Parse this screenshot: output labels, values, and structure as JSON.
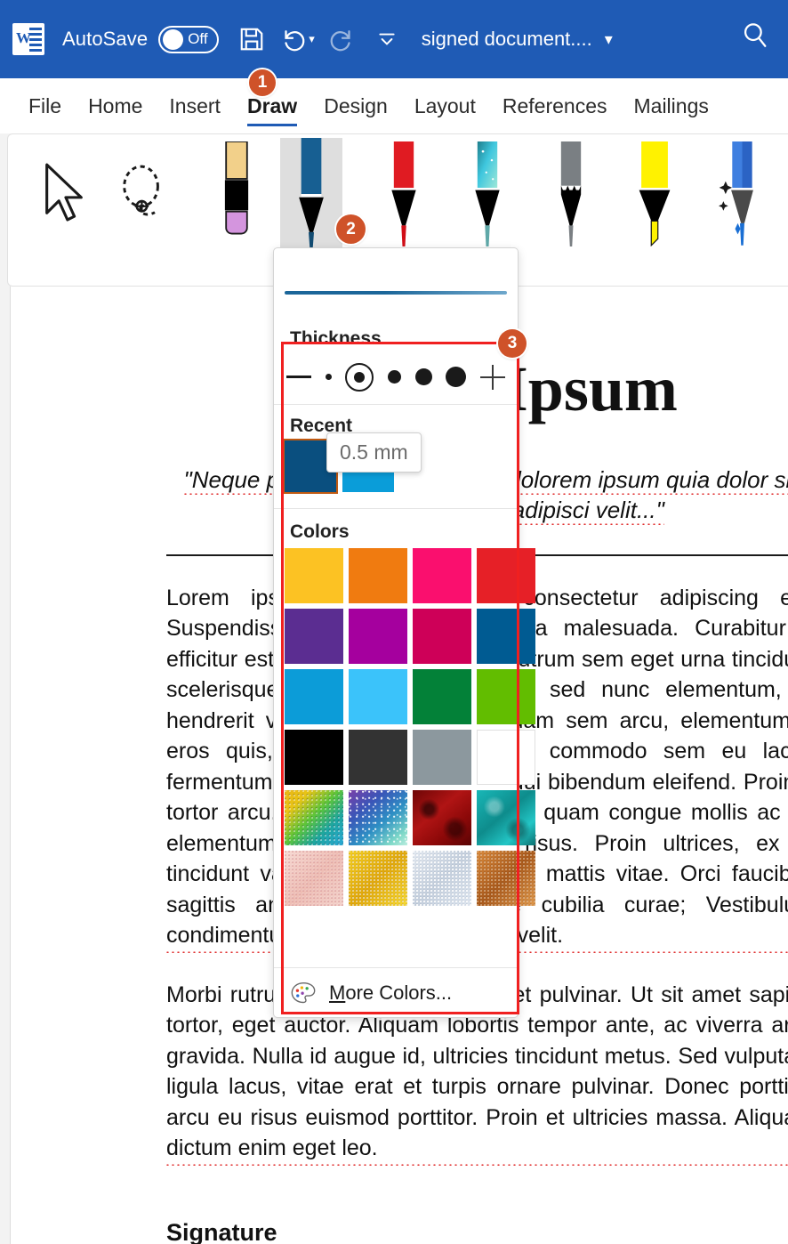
{
  "titlebar": {
    "logo_name": "word-logo",
    "autosave_label": "AutoSave",
    "autosave_state": "Off",
    "save_icon": "save-icon",
    "undo_icon": "undo-icon",
    "redo_icon": "redo-icon",
    "customize_icon": "customize-quick-access-icon",
    "document_title": "signed document....",
    "title_chevron": "chevron-down-icon",
    "search_icon": "search-icon",
    "accent_color": "#1f5bb5"
  },
  "ribbon": {
    "tabs": [
      {
        "label": "File",
        "active": false
      },
      {
        "label": "Home",
        "active": false
      },
      {
        "label": "Insert",
        "active": false
      },
      {
        "label": "Draw",
        "active": true
      },
      {
        "label": "Design",
        "active": false
      },
      {
        "label": "Layout",
        "active": false
      },
      {
        "label": "References",
        "active": false
      },
      {
        "label": "Mailings",
        "active": false
      }
    ]
  },
  "pen_toolbar": {
    "tools": [
      {
        "name": "select-tool",
        "kind": "cursor",
        "selected": false
      },
      {
        "name": "lasso-select-tool",
        "kind": "lasso",
        "selected": false
      },
      {
        "name": "eraser-tool",
        "kind": "eraser",
        "barrel": "#F2D08A",
        "mid": "#000000",
        "tip": "#D495DE",
        "selected": false
      },
      {
        "name": "pen-blue",
        "kind": "pen",
        "barrel": "#175F92",
        "mid": "#000000",
        "tip": "#124C72",
        "selected": true
      },
      {
        "name": "pen-red",
        "kind": "pen",
        "barrel": "#E01B22",
        "mid": "#000000",
        "tip": "#D10E17",
        "selected": false
      },
      {
        "name": "pen-galaxy",
        "kind": "pen",
        "barrel": "galaxy",
        "mid": "#000000",
        "tip": "#5FA8A8",
        "selected": false
      },
      {
        "name": "pencil-gray",
        "kind": "pencil",
        "barrel": "#7A7F83",
        "mid": "#000000",
        "tip": "#7A7F83",
        "selected": false
      },
      {
        "name": "highlighter-yellow",
        "kind": "highlighter",
        "barrel": "#FFF200",
        "mid": "#000000",
        "tip": "#FFF200",
        "selected": false
      },
      {
        "name": "action-pen",
        "kind": "action",
        "barrel": "#3F7FE0",
        "mid": "#4A4A4A",
        "tip": "#1A6FD4",
        "selected": false
      }
    ]
  },
  "flyout": {
    "preview_color": "#1b6699",
    "thickness": {
      "title": "Thickness",
      "minus_label": "decrease-thickness",
      "plus_label": "increase-thickness",
      "options": [
        {
          "size": 7,
          "selected": false,
          "value": "0.25 mm"
        },
        {
          "size": 12,
          "selected": true,
          "value": "0.5 mm"
        },
        {
          "size": 15,
          "selected": false,
          "value": "1 mm"
        },
        {
          "size": 19,
          "selected": false,
          "value": "1.5 mm"
        },
        {
          "size": 23,
          "selected": false,
          "value": "2 mm"
        }
      ],
      "tooltip": "0.5 mm"
    },
    "recent": {
      "title": "Recent",
      "swatches": [
        {
          "color": "#0A4F7F",
          "selected": true
        },
        {
          "color": "#0A9DD9",
          "selected": false
        }
      ]
    },
    "colors": {
      "title": "Colors",
      "grid": [
        {
          "name": "color-gold",
          "color": "#FCC223",
          "type": "solid"
        },
        {
          "name": "color-orange",
          "color": "#F07B10",
          "type": "solid"
        },
        {
          "name": "color-pink",
          "color": "#FA0F6E",
          "type": "solid"
        },
        {
          "name": "color-red",
          "color": "#E62027",
          "type": "solid"
        },
        {
          "name": "color-purple",
          "color": "#5B2D91",
          "type": "solid"
        },
        {
          "name": "color-magenta",
          "color": "#A5009E",
          "type": "solid"
        },
        {
          "name": "color-rose",
          "color": "#CE0058",
          "type": "solid"
        },
        {
          "name": "color-dark-blue",
          "color": "#005B92",
          "type": "solid"
        },
        {
          "name": "color-blue",
          "color": "#0C9CD8",
          "type": "solid"
        },
        {
          "name": "color-light-blue",
          "color": "#3BC3FA",
          "type": "solid"
        },
        {
          "name": "color-green",
          "color": "#038138",
          "type": "solid"
        },
        {
          "name": "color-light-green",
          "color": "#62BD00",
          "type": "solid"
        },
        {
          "name": "color-black",
          "color": "#000000",
          "type": "solid"
        },
        {
          "name": "color-dark-gray",
          "color": "#333333",
          "type": "solid"
        },
        {
          "name": "color-gray",
          "color": "#8C989E",
          "type": "solid"
        },
        {
          "name": "color-white",
          "color": "#FFFFFF",
          "type": "solid"
        },
        {
          "name": "texture-rainbow",
          "color": "#39A83C",
          "type": "texture"
        },
        {
          "name": "texture-galaxy",
          "color": "#3C4C9C",
          "type": "texture"
        },
        {
          "name": "texture-lava",
          "color": "#8E0B0B",
          "type": "texture"
        },
        {
          "name": "texture-ocean",
          "color": "#16A6A6",
          "type": "texture"
        },
        {
          "name": "texture-rose-gold",
          "color": "#EFC3BC",
          "type": "texture"
        },
        {
          "name": "texture-gold",
          "color": "#E8BB1A",
          "type": "texture"
        },
        {
          "name": "texture-silver",
          "color": "#C9D2DD",
          "type": "texture"
        },
        {
          "name": "texture-bronze",
          "color": "#C1712A",
          "type": "texture"
        }
      ]
    },
    "more_colors": {
      "icon": "palette-icon",
      "accesskey": "M",
      "label_rest": "ore Colors..."
    },
    "highlight_border_color": "#f02020"
  },
  "document": {
    "heading": "Lorem Ipsum",
    "quote": "\"Neque porro quisquam est qui dolorem ipsum quia dolor sit amet, consectetur, adipisci velit...\"",
    "paragraphs": [
      "Lorem ipsum dolor sit amet, consectetur adipiscing elit. Suspendisse tincidunt sed lectus a malesuada. Curabitur a efficitur est, id ornare lectus. Nulla rutrum sem eget urna tincidunt scelerisque. Etiam ullamcorper elit sed nunc elementum, in hendrerit velit aliquet lacinia. Aliquam sem arcu, elementum a eros quis, accumsan eros. Fusce commodo sem eu lacus fermentum. Aliquam et ipsum quis dui bibendum eleifend. Proin a tortor arcu. Phasellus tellus sit amet quam congue mollis ac eu elementum. Quisque elementum risus. Proin ultrices, ex ut tincidunt varius, nibh hendrerit risus mattis vitae. Orci faucibus sagittis ante, primis in posuere cubilia curae; Vestibulum condimentum nisl eget ullamcorper velit.",
      "Morbi rutrum nibh quis lorem aliquet pulvinar. Ut sit amet sapien tortor, eget auctor. Aliquam lobortis tempor ante, ac viverra arcu gravida. Nulla id augue id, ultricies tincidunt metus. Sed vulputate ligula lacus, vitae erat et turpis ornare pulvinar. Donec porttitor arcu eu risus euismod porttitor. Proin et ultricies massa. Aliquam dictum enim eget leo."
    ],
    "signature_heading": "Signature"
  },
  "callouts": [
    {
      "number": "1",
      "name": "callout-badge-1"
    },
    {
      "number": "2",
      "name": "callout-badge-2"
    },
    {
      "number": "3",
      "name": "callout-badge-3"
    }
  ]
}
